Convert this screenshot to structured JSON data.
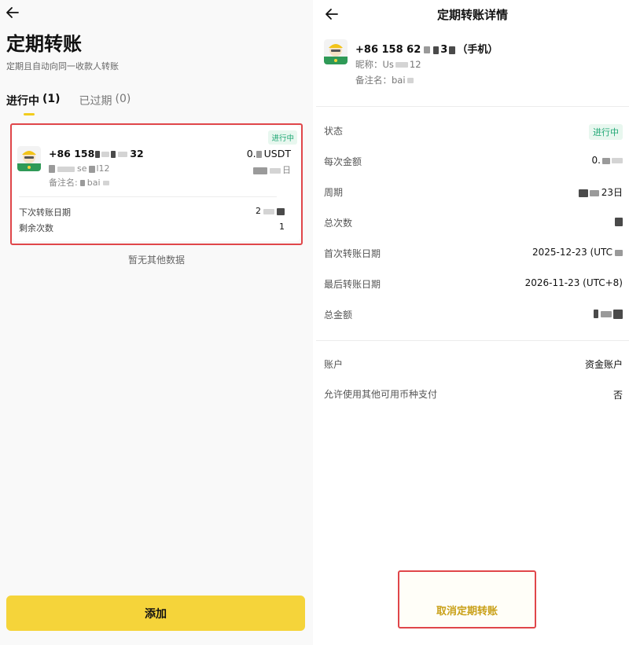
{
  "left": {
    "title": "定期转账",
    "subtitle": "定期且自动向同一收款人转账",
    "tabs": [
      {
        "label": "进行中",
        "count": "(1)"
      },
      {
        "label": "已过期",
        "count": "(0)"
      }
    ],
    "card": {
      "status": "进行中",
      "phone_prefix": "+86 158",
      "phone_suffix": "32",
      "amount_prefix": "0.",
      "amount_unit": "USDT",
      "nickname_partial": "se",
      "nickname_tail": "l12",
      "nick_right_suffix": "日",
      "remark_prefix": "备注名:",
      "remark_value": "bai",
      "next_date_label": "下次转账日期",
      "remaining_label": "剩余次数",
      "next_date_value": "2",
      "remaining_value": "1"
    },
    "no_more": "暂无其他数据",
    "add_button": "添加"
  },
  "right": {
    "title": "定期转账详情",
    "phone_prefix": "+86 158 62",
    "phone_mid": "3",
    "phone_suffix": "（手机）",
    "nickname_label": "昵称：",
    "nickname_value": "Us",
    "nickname_tail": "12",
    "remark_label": "备注名：",
    "remark_value": "bai",
    "rows": {
      "status": {
        "label": "状态",
        "value": "进行中"
      },
      "each_amount": {
        "label": "每次金额",
        "value": "0."
      },
      "cycle": {
        "label": "周期",
        "value": "23日"
      },
      "total_count": {
        "label": "总次数"
      },
      "first_date": {
        "label": "首次转账日期",
        "value": "2025-12-23 (UTC"
      },
      "last_date": {
        "label": "最后转账日期",
        "value": "2026-11-23 (UTC+8)"
      },
      "total_amount": {
        "label": "总金额"
      },
      "account": {
        "label": "账户",
        "value": "资金账户"
      },
      "allow_other": {
        "label": "允许使用其他可用币种支付",
        "value": "否"
      }
    },
    "cancel_button": "取消定期转账"
  },
  "colors": {
    "accent_yellow": "#f5d43a",
    "status_green": "#1fa774",
    "highlight_red": "#e0464a",
    "cancel_text": "#c9a017"
  }
}
